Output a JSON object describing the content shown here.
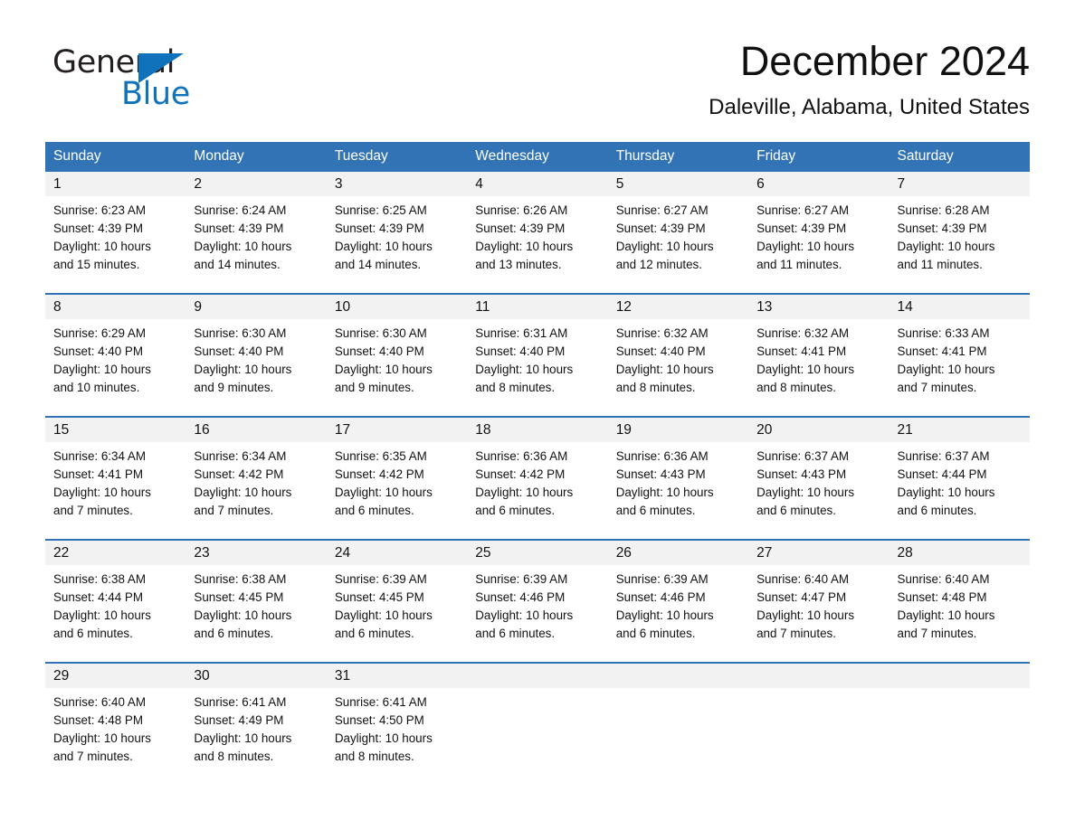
{
  "logo": {
    "word_one": "General",
    "word_two": "Blue",
    "triangle_color": "#0f72bb",
    "icon": "triangle-icon"
  },
  "header": {
    "title": "December 2024",
    "location": "Daleville, Alabama, United States",
    "accent_color": "#3273b6",
    "band_color": "#f2f2f2"
  },
  "calendar": {
    "weekday_headers": [
      "Sunday",
      "Monday",
      "Tuesday",
      "Wednesday",
      "Thursday",
      "Friday",
      "Saturday"
    ],
    "weeks": [
      [
        {
          "day": "1",
          "sunrise": "Sunrise: 6:23 AM",
          "sunset": "Sunset: 4:39 PM",
          "daylight1": "Daylight: 10 hours",
          "daylight2": "and 15 minutes."
        },
        {
          "day": "2",
          "sunrise": "Sunrise: 6:24 AM",
          "sunset": "Sunset: 4:39 PM",
          "daylight1": "Daylight: 10 hours",
          "daylight2": "and 14 minutes."
        },
        {
          "day": "3",
          "sunrise": "Sunrise: 6:25 AM",
          "sunset": "Sunset: 4:39 PM",
          "daylight1": "Daylight: 10 hours",
          "daylight2": "and 14 minutes."
        },
        {
          "day": "4",
          "sunrise": "Sunrise: 6:26 AM",
          "sunset": "Sunset: 4:39 PM",
          "daylight1": "Daylight: 10 hours",
          "daylight2": "and 13 minutes."
        },
        {
          "day": "5",
          "sunrise": "Sunrise: 6:27 AM",
          "sunset": "Sunset: 4:39 PM",
          "daylight1": "Daylight: 10 hours",
          "daylight2": "and 12 minutes."
        },
        {
          "day": "6",
          "sunrise": "Sunrise: 6:27 AM",
          "sunset": "Sunset: 4:39 PM",
          "daylight1": "Daylight: 10 hours",
          "daylight2": "and 11 minutes."
        },
        {
          "day": "7",
          "sunrise": "Sunrise: 6:28 AM",
          "sunset": "Sunset: 4:39 PM",
          "daylight1": "Daylight: 10 hours",
          "daylight2": "and 11 minutes."
        }
      ],
      [
        {
          "day": "8",
          "sunrise": "Sunrise: 6:29 AM",
          "sunset": "Sunset: 4:40 PM",
          "daylight1": "Daylight: 10 hours",
          "daylight2": "and 10 minutes."
        },
        {
          "day": "9",
          "sunrise": "Sunrise: 6:30 AM",
          "sunset": "Sunset: 4:40 PM",
          "daylight1": "Daylight: 10 hours",
          "daylight2": "and 9 minutes."
        },
        {
          "day": "10",
          "sunrise": "Sunrise: 6:30 AM",
          "sunset": "Sunset: 4:40 PM",
          "daylight1": "Daylight: 10 hours",
          "daylight2": "and 9 minutes."
        },
        {
          "day": "11",
          "sunrise": "Sunrise: 6:31 AM",
          "sunset": "Sunset: 4:40 PM",
          "daylight1": "Daylight: 10 hours",
          "daylight2": "and 8 minutes."
        },
        {
          "day": "12",
          "sunrise": "Sunrise: 6:32 AM",
          "sunset": "Sunset: 4:40 PM",
          "daylight1": "Daylight: 10 hours",
          "daylight2": "and 8 minutes."
        },
        {
          "day": "13",
          "sunrise": "Sunrise: 6:32 AM",
          "sunset": "Sunset: 4:41 PM",
          "daylight1": "Daylight: 10 hours",
          "daylight2": "and 8 minutes."
        },
        {
          "day": "14",
          "sunrise": "Sunrise: 6:33 AM",
          "sunset": "Sunset: 4:41 PM",
          "daylight1": "Daylight: 10 hours",
          "daylight2": "and 7 minutes."
        }
      ],
      [
        {
          "day": "15",
          "sunrise": "Sunrise: 6:34 AM",
          "sunset": "Sunset: 4:41 PM",
          "daylight1": "Daylight: 10 hours",
          "daylight2": "and 7 minutes."
        },
        {
          "day": "16",
          "sunrise": "Sunrise: 6:34 AM",
          "sunset": "Sunset: 4:42 PM",
          "daylight1": "Daylight: 10 hours",
          "daylight2": "and 7 minutes."
        },
        {
          "day": "17",
          "sunrise": "Sunrise: 6:35 AM",
          "sunset": "Sunset: 4:42 PM",
          "daylight1": "Daylight: 10 hours",
          "daylight2": "and 6 minutes."
        },
        {
          "day": "18",
          "sunrise": "Sunrise: 6:36 AM",
          "sunset": "Sunset: 4:42 PM",
          "daylight1": "Daylight: 10 hours",
          "daylight2": "and 6 minutes."
        },
        {
          "day": "19",
          "sunrise": "Sunrise: 6:36 AM",
          "sunset": "Sunset: 4:43 PM",
          "daylight1": "Daylight: 10 hours",
          "daylight2": "and 6 minutes."
        },
        {
          "day": "20",
          "sunrise": "Sunrise: 6:37 AM",
          "sunset": "Sunset: 4:43 PM",
          "daylight1": "Daylight: 10 hours",
          "daylight2": "and 6 minutes."
        },
        {
          "day": "21",
          "sunrise": "Sunrise: 6:37 AM",
          "sunset": "Sunset: 4:44 PM",
          "daylight1": "Daylight: 10 hours",
          "daylight2": "and 6 minutes."
        }
      ],
      [
        {
          "day": "22",
          "sunrise": "Sunrise: 6:38 AM",
          "sunset": "Sunset: 4:44 PM",
          "daylight1": "Daylight: 10 hours",
          "daylight2": "and 6 minutes."
        },
        {
          "day": "23",
          "sunrise": "Sunrise: 6:38 AM",
          "sunset": "Sunset: 4:45 PM",
          "daylight1": "Daylight: 10 hours",
          "daylight2": "and 6 minutes."
        },
        {
          "day": "24",
          "sunrise": "Sunrise: 6:39 AM",
          "sunset": "Sunset: 4:45 PM",
          "daylight1": "Daylight: 10 hours",
          "daylight2": "and 6 minutes."
        },
        {
          "day": "25",
          "sunrise": "Sunrise: 6:39 AM",
          "sunset": "Sunset: 4:46 PM",
          "daylight1": "Daylight: 10 hours",
          "daylight2": "and 6 minutes."
        },
        {
          "day": "26",
          "sunrise": "Sunrise: 6:39 AM",
          "sunset": "Sunset: 4:46 PM",
          "daylight1": "Daylight: 10 hours",
          "daylight2": "and 6 minutes."
        },
        {
          "day": "27",
          "sunrise": "Sunrise: 6:40 AM",
          "sunset": "Sunset: 4:47 PM",
          "daylight1": "Daylight: 10 hours",
          "daylight2": "and 7 minutes."
        },
        {
          "day": "28",
          "sunrise": "Sunrise: 6:40 AM",
          "sunset": "Sunset: 4:48 PM",
          "daylight1": "Daylight: 10 hours",
          "daylight2": "and 7 minutes."
        }
      ],
      [
        {
          "day": "29",
          "sunrise": "Sunrise: 6:40 AM",
          "sunset": "Sunset: 4:48 PM",
          "daylight1": "Daylight: 10 hours",
          "daylight2": "and 7 minutes."
        },
        {
          "day": "30",
          "sunrise": "Sunrise: 6:41 AM",
          "sunset": "Sunset: 4:49 PM",
          "daylight1": "Daylight: 10 hours",
          "daylight2": "and 8 minutes."
        },
        {
          "day": "31",
          "sunrise": "Sunrise: 6:41 AM",
          "sunset": "Sunset: 4:50 PM",
          "daylight1": "Daylight: 10 hours",
          "daylight2": "and 8 minutes."
        },
        {
          "day": "",
          "sunrise": "",
          "sunset": "",
          "daylight1": "",
          "daylight2": ""
        },
        {
          "day": "",
          "sunrise": "",
          "sunset": "",
          "daylight1": "",
          "daylight2": ""
        },
        {
          "day": "",
          "sunrise": "",
          "sunset": "",
          "daylight1": "",
          "daylight2": ""
        },
        {
          "day": "",
          "sunrise": "",
          "sunset": "",
          "daylight1": "",
          "daylight2": ""
        }
      ]
    ]
  }
}
